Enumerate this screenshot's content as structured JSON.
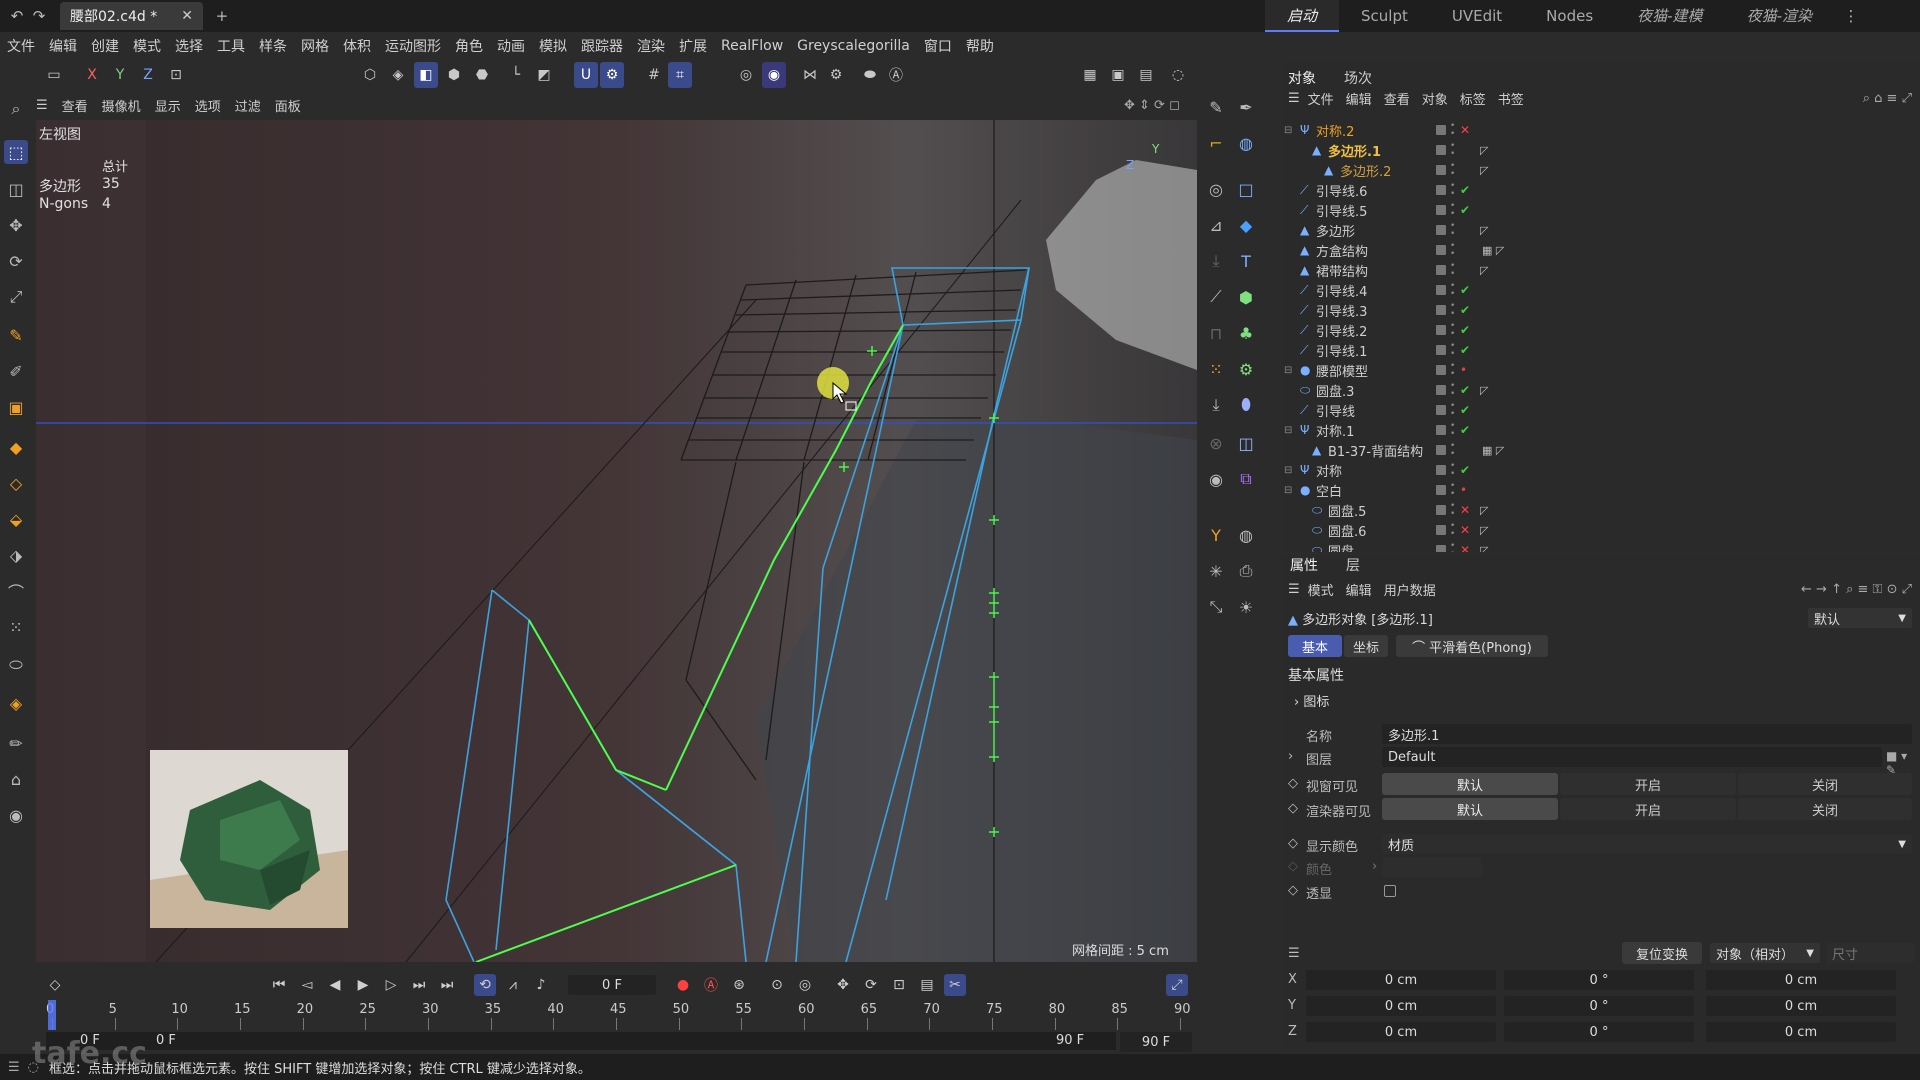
{
  "titlebar": {
    "undo": "↶",
    "redo": "↷",
    "doc_tab": "腰部02.c4d *",
    "close": "✕",
    "add": "+",
    "layouts": [
      "启动",
      "Sculpt",
      "UVEdit",
      "Nodes",
      "夜猫-建模",
      "夜猫-渲染"
    ],
    "more": "⋮"
  },
  "menubar": [
    "文件",
    "编辑",
    "创建",
    "模式",
    "选择",
    "工具",
    "样条",
    "网格",
    "体积",
    "运动图形",
    "角色",
    "动画",
    "模拟",
    "跟踪器",
    "渲染",
    "扩展",
    "RealFlow",
    "Greyscalegorilla",
    "窗口",
    "帮助"
  ],
  "toptools": {
    "axis_x": "X",
    "axis_y": "Y",
    "axis_z": "Z"
  },
  "viewport": {
    "menu": [
      "查看",
      "摄像机",
      "显示",
      "选项",
      "过滤",
      "面板"
    ],
    "view_name": "左视图",
    "stats_header": "总计",
    "stats": [
      {
        "label": "多边形",
        "value": "35"
      },
      {
        "label": "N-gons",
        "value": "4"
      }
    ],
    "grid_spacing": "网格间距 : 5 cm",
    "axis_z": "Z",
    "axis_y": "Y"
  },
  "object_panel": {
    "tabs": [
      "对象",
      "场次"
    ],
    "menu": [
      "文件",
      "编辑",
      "查看",
      "对象",
      "标签",
      "书签"
    ],
    "objects": [
      {
        "name": "对称.2",
        "indent": 0,
        "color": "#f0a020",
        "icon": "symmetry-icon",
        "status": "x"
      },
      {
        "name": "多边形.1",
        "indent": 1,
        "color": "#f0c040",
        "icon": "polygon-icon",
        "status": "tag",
        "bold": true
      },
      {
        "name": "多边形.2",
        "indent": 2,
        "color": "#d0a040",
        "icon": "polygon-icon",
        "status": "tag"
      },
      {
        "name": "引导线.6",
        "indent": 0,
        "color": "#cfcfcf",
        "icon": "spline-icon",
        "status": "check"
      },
      {
        "name": "引导线.5",
        "indent": 0,
        "color": "#cfcfcf",
        "icon": "spline-icon",
        "status": "check"
      },
      {
        "name": "多边形",
        "indent": 0,
        "color": "#cfcfcf",
        "icon": "polygon-icon",
        "status": "tag"
      },
      {
        "name": "方盒结构",
        "indent": 0,
        "color": "#cfcfcf",
        "icon": "polygon-icon",
        "status": "tag2"
      },
      {
        "name": "裙带结构",
        "indent": 0,
        "color": "#cfcfcf",
        "icon": "polygon-icon",
        "status": "tag"
      },
      {
        "name": "引导线.4",
        "indent": 0,
        "color": "#cfcfcf",
        "icon": "spline-icon",
        "status": "check"
      },
      {
        "name": "引导线.3",
        "indent": 0,
        "color": "#cfcfcf",
        "icon": "spline-icon",
        "status": "check"
      },
      {
        "name": "引导线.2",
        "indent": 0,
        "color": "#cfcfcf",
        "icon": "spline-icon",
        "status": "check"
      },
      {
        "name": "引导线.1",
        "indent": 0,
        "color": "#cfcfcf",
        "icon": "spline-icon",
        "status": "check"
      },
      {
        "name": "腰部模型",
        "indent": 0,
        "color": "#cfcfcf",
        "icon": "null-icon",
        "status": "dot"
      },
      {
        "name": "圆盘.3",
        "indent": 0,
        "color": "#cfcfcf",
        "icon": "disc-icon",
        "status": "checktag"
      },
      {
        "name": "引导线",
        "indent": 0,
        "color": "#cfcfcf",
        "icon": "spline-icon",
        "status": "check"
      },
      {
        "name": "对称.1",
        "indent": 0,
        "color": "#cfcfcf",
        "icon": "symmetry-icon",
        "status": "check"
      },
      {
        "name": "B1-37-背面结构",
        "indent": 1,
        "color": "#cfcfcf",
        "icon": "polygon-icon",
        "status": "tag2"
      },
      {
        "name": "对称",
        "indent": 0,
        "color": "#cfcfcf",
        "icon": "symmetry-icon",
        "status": "check"
      },
      {
        "name": "空白",
        "indent": 0,
        "color": "#cfcfcf",
        "icon": "null-icon",
        "status": "dot"
      },
      {
        "name": "圆盘.5",
        "indent": 1,
        "color": "#cfcfcf",
        "icon": "disc-icon",
        "status": "xtag"
      },
      {
        "name": "圆盘.6",
        "indent": 1,
        "color": "#cfcfcf",
        "icon": "disc-icon",
        "status": "xtag"
      },
      {
        "name": "圆盘",
        "indent": 1,
        "color": "#cfcfcf",
        "icon": "disc-icon",
        "status": "xtag"
      }
    ]
  },
  "attributes": {
    "tabs": [
      "属性",
      "层"
    ],
    "menu": [
      "模式",
      "编辑",
      "用户数据"
    ],
    "object_title": "多边形对象 [多边形.1]",
    "preset": "默认",
    "subtabs": [
      "基本",
      "坐标",
      "平滑着色(Phong)"
    ],
    "section": "基本属性",
    "icon_group": "图标",
    "fields": {
      "name_label": "名称",
      "name_value": "多边形.1",
      "layer_label": "图层",
      "layer_value": "Default",
      "viewport_visible_label": "视窗可见",
      "render_visible_label": "渲染器可见",
      "opt_default": "默认",
      "opt_on": "开启",
      "opt_off": "关闭",
      "display_color_label": "显示颜色",
      "display_color_value": "材质",
      "color_label": "颜色",
      "xray_label": "透显"
    },
    "coords": {
      "reset_button": "复位变换",
      "mode": "对象（相对）",
      "size_label": "尺寸",
      "rows": [
        {
          "axis": "X",
          "pos": "0 cm",
          "rot": "0 °",
          "scale": "0 cm"
        },
        {
          "axis": "Y",
          "pos": "0 cm",
          "rot": "0 °",
          "scale": "0 cm"
        },
        {
          "axis": "Z",
          "pos": "0 cm",
          "rot": "0 °",
          "scale": "0 cm"
        }
      ]
    }
  },
  "timeline": {
    "current_frame": "0 F",
    "ticks": [
      "0",
      "5",
      "10",
      "15",
      "20",
      "25",
      "30",
      "35",
      "40",
      "45",
      "50",
      "55",
      "60",
      "65",
      "70",
      "75",
      "80",
      "85",
      "90"
    ],
    "start": "0 F",
    "start2": "0 F",
    "end": "90 F",
    "end2": "90 F"
  },
  "status": {
    "text": "框选：点击并拖动鼠标框选元素。按住 SHIFT 键增加选择对象；按住 CTRL 键减少选择对象。",
    "watermark": "tafe.cc"
  },
  "colors": {
    "accent": "#5b7cff",
    "green_wire": "#4cff4c",
    "blue_wire": "#3ba3e0"
  }
}
